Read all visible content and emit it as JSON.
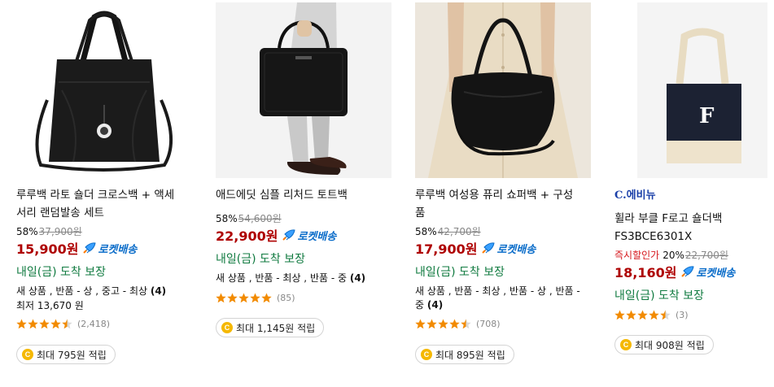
{
  "colors": {
    "price": "#ae0000",
    "rocket": "#0a6cc9",
    "arrival": "#0f7a3f",
    "brand": "#1a3fa8",
    "star": "#f28b00",
    "coin": "#f5b800"
  },
  "products": [
    {
      "title": "루루백 라토 숄더 크로스백 + 액세서리 랜덤발송 세트",
      "discount": "58%",
      "original_price": "37,900원",
      "price": "15,900원",
      "rocket": "로켓배송",
      "arrival": "내일(금) 도착 보장",
      "used_info_prefix": "새 상품 , 반품 - 상 , 중고 - 최상 ",
      "used_info_count": "(4)",
      "lowest": "최저 13,670 원",
      "rating": 4.5,
      "review_count": "(2,418)",
      "reward_icon": "C",
      "reward": "최대 795원 적립"
    },
    {
      "title": "애드에딧 심플 리처드 토트백",
      "discount": "58%",
      "original_price": "54,600원",
      "price": "22,900원",
      "rocket": "로켓배송",
      "arrival": "내일(금) 도착 보장",
      "used_info_prefix": "새 상품 , 반품 - 최상 , 반품 - 중 ",
      "used_info_count": "(4)",
      "rating": 5,
      "review_count": "(85)",
      "reward_icon": "C",
      "reward": "최대 1,145원 적립"
    },
    {
      "title": "루루백 여성용 퓨리 쇼퍼백 + 구성품",
      "discount": "58%",
      "original_price": "42,700원",
      "price": "17,900원",
      "rocket": "로켓배송",
      "arrival": "내일(금) 도착 보장",
      "used_info_prefix": "새 상품 , 반품 - 최상 , 반품 - 상 , 반품 - 중 ",
      "used_info_count": "(4)",
      "rating": 4.5,
      "review_count": "(708)",
      "reward_icon": "C",
      "reward": "최대 895원 적립"
    },
    {
      "brand": "C.에비뉴",
      "title": "휠라 부클 F로고 숄더백 FS3BCE6301X",
      "instant_label": "즉시할인가",
      "discount": "20%",
      "original_price": "22,700원",
      "price": "18,160원",
      "rocket": "로켓배송",
      "arrival": "내일(금) 도착 보장",
      "rating": 4.5,
      "review_count": "(3)",
      "reward_icon": "C",
      "reward": "최대 908원 적립"
    }
  ]
}
